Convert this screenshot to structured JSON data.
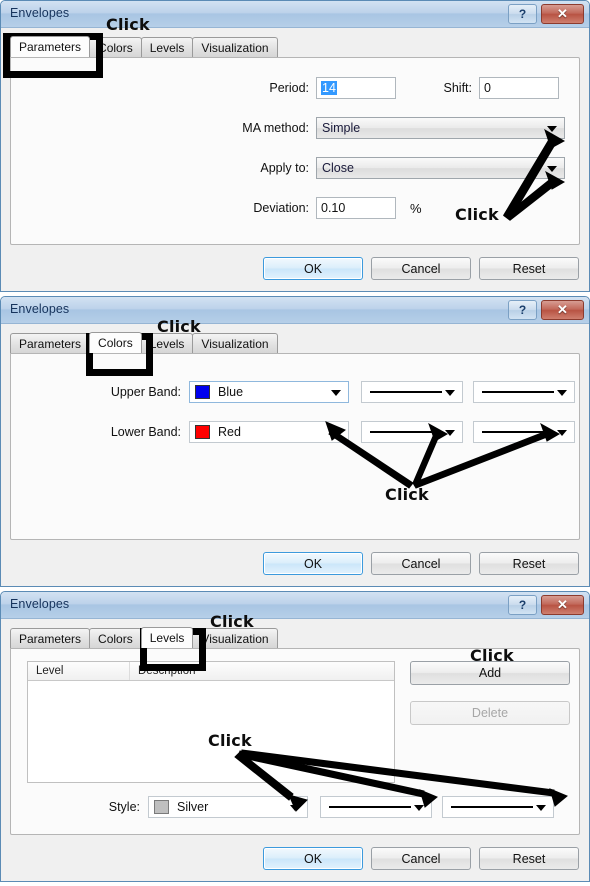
{
  "window": {
    "title": "Envelopes",
    "help_label": "?",
    "close_label": "✕"
  },
  "tabs": [
    "Parameters",
    "Colors",
    "Levels",
    "Visualization"
  ],
  "footer_buttons": {
    "ok": "OK",
    "cancel": "Cancel",
    "reset": "Reset"
  },
  "annotation": {
    "click": "Click"
  },
  "dialog1": {
    "active_tab": "Parameters",
    "fields": {
      "period_label": "Period:",
      "period_value": "14",
      "shift_label": "Shift:",
      "shift_value": "0",
      "ma_method_label": "MA method:",
      "ma_method_value": "Simple",
      "apply_to_label": "Apply to:",
      "apply_to_value": "Close",
      "deviation_label": "Deviation:",
      "deviation_value": "0.10",
      "percent_symbol": "%"
    }
  },
  "dialog2": {
    "active_tab": "Colors",
    "fields": {
      "upper_band_label": "Upper Band:",
      "upper_band_color": "Blue",
      "upper_band_color_hex": "#0000ee",
      "lower_band_label": "Lower Band:",
      "lower_band_color": "Red",
      "lower_band_color_hex": "#ff0000"
    }
  },
  "dialog3": {
    "active_tab": "Levels",
    "table": {
      "columns": [
        "Level",
        "Description"
      ],
      "rows": []
    },
    "buttons": {
      "add": "Add",
      "delete": "Delete"
    },
    "style": {
      "label": "Style:",
      "color": "Silver",
      "color_hex": "#bfbfbf"
    }
  }
}
